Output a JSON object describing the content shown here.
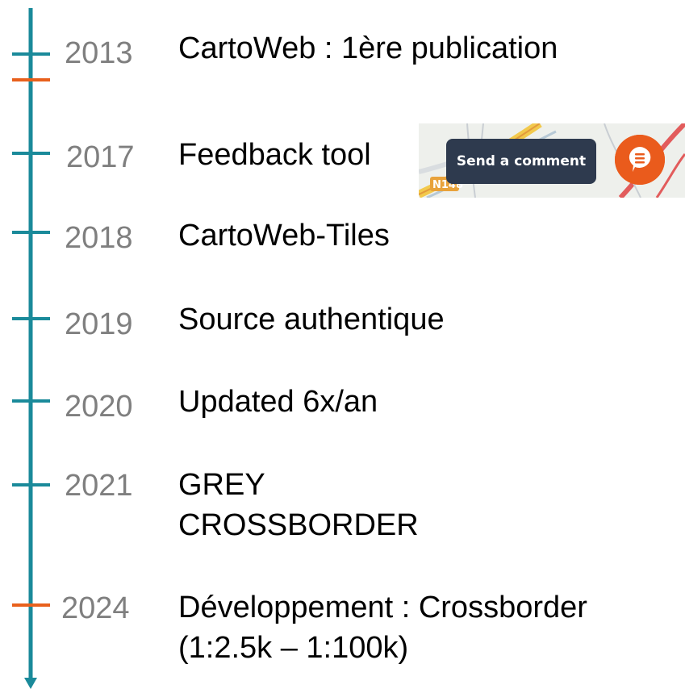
{
  "timeline": {
    "line_color": "#1a8a9a",
    "highlight_color": "#e8601c",
    "year_color": "#7f7f7f",
    "entries": [
      {
        "year": "2013",
        "lines": [
          "CartoWeb : 1ère publication"
        ]
      },
      {
        "year": "2017",
        "lines": [
          "Feedback tool"
        ]
      },
      {
        "year": "2018",
        "lines": [
          "CartoWeb-Tiles"
        ]
      },
      {
        "year": "2019",
        "lines": [
          "Source authentique"
        ]
      },
      {
        "year": "2020",
        "lines": [
          "Updated 6x/an"
        ]
      },
      {
        "year": "2021",
        "lines": [
          "GREY",
          "CROSSBORDER"
        ]
      },
      {
        "year": "2024",
        "lines": [
          "Développement : Crossborder",
          "(1:2.5k – 1:100k)"
        ]
      }
    ]
  },
  "feedback_widget": {
    "button_label": "Send a comment",
    "button_color": "#2e3a4e",
    "fab_color": "#ea5b1c",
    "fab_icon": "comment-icon",
    "map_road_label": "N148"
  }
}
